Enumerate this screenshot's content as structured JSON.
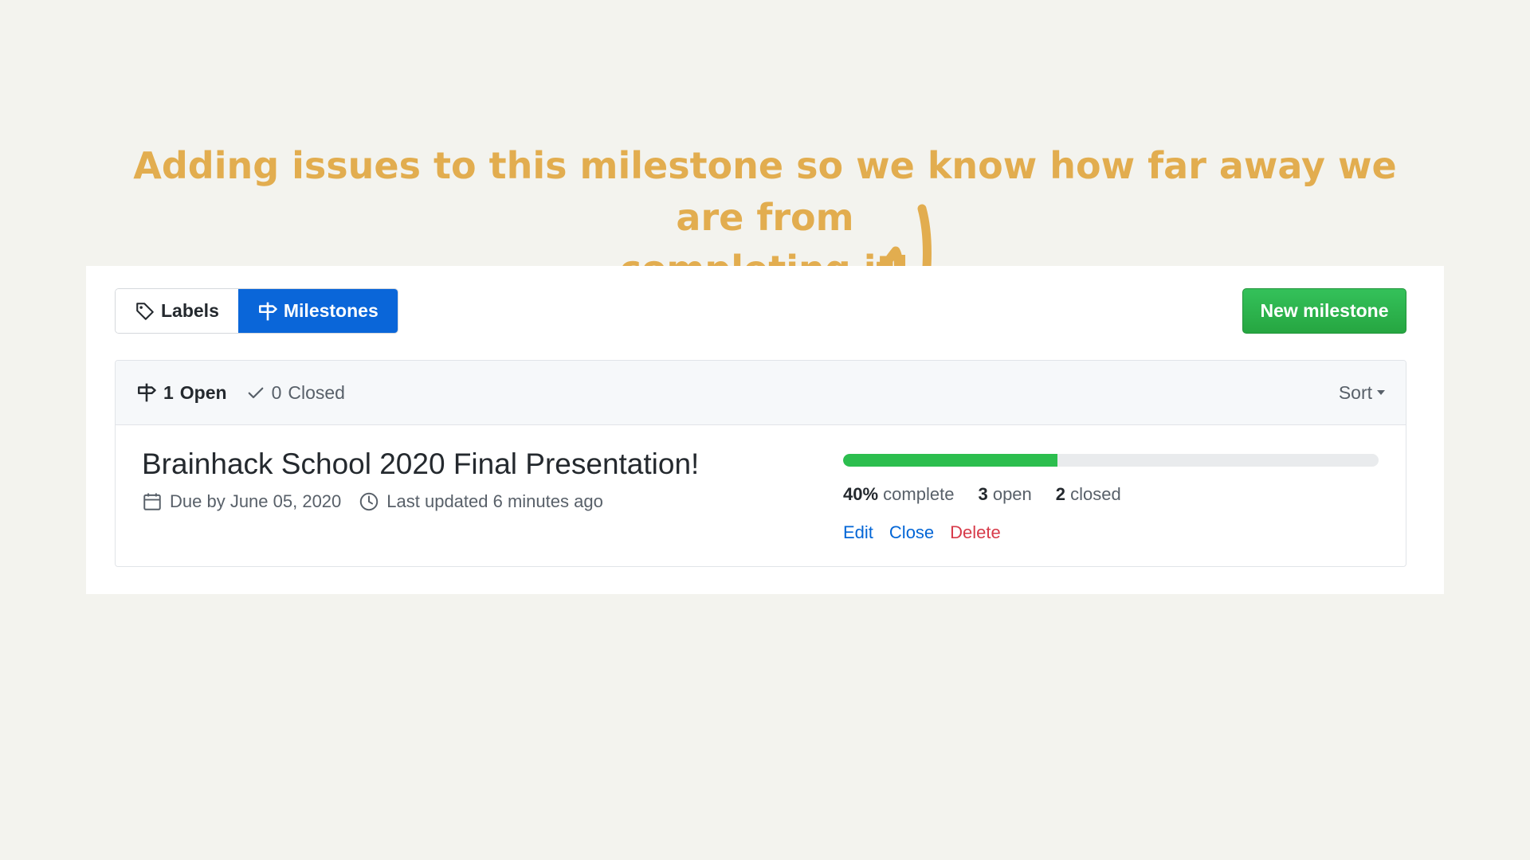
{
  "annotation": {
    "line1": "Adding issues to this milestone so we know how far away we are from",
    "line2": "completing it!",
    "color": "#e2ad4f"
  },
  "tabs": [
    {
      "label": "Labels",
      "icon": "tag-icon",
      "active": false
    },
    {
      "label": "Milestones",
      "icon": "milestone-icon",
      "active": true
    }
  ],
  "new_milestone_label": "New milestone",
  "filters": {
    "open_count": "1",
    "open_label": "Open",
    "closed_count": "0",
    "closed_label": "Closed"
  },
  "sort_label": "Sort",
  "milestone": {
    "title": "Brainhack School 2020 Final Presentation!",
    "due": "Due by June 05, 2020",
    "updated": "Last updated 6 minutes ago",
    "progress_fraction": 0.4,
    "percent_value": "40%",
    "percent_label": "complete",
    "open_count": "3",
    "open_label": "open",
    "closed_count": "2",
    "closed_label": "closed",
    "actions": {
      "edit": "Edit",
      "close": "Close",
      "delete": "Delete"
    }
  },
  "colors": {
    "accent_blue": "#0a66d9",
    "success_green": "#2cbe4e",
    "danger_red": "#d73a49",
    "link_blue": "#0366d6"
  }
}
